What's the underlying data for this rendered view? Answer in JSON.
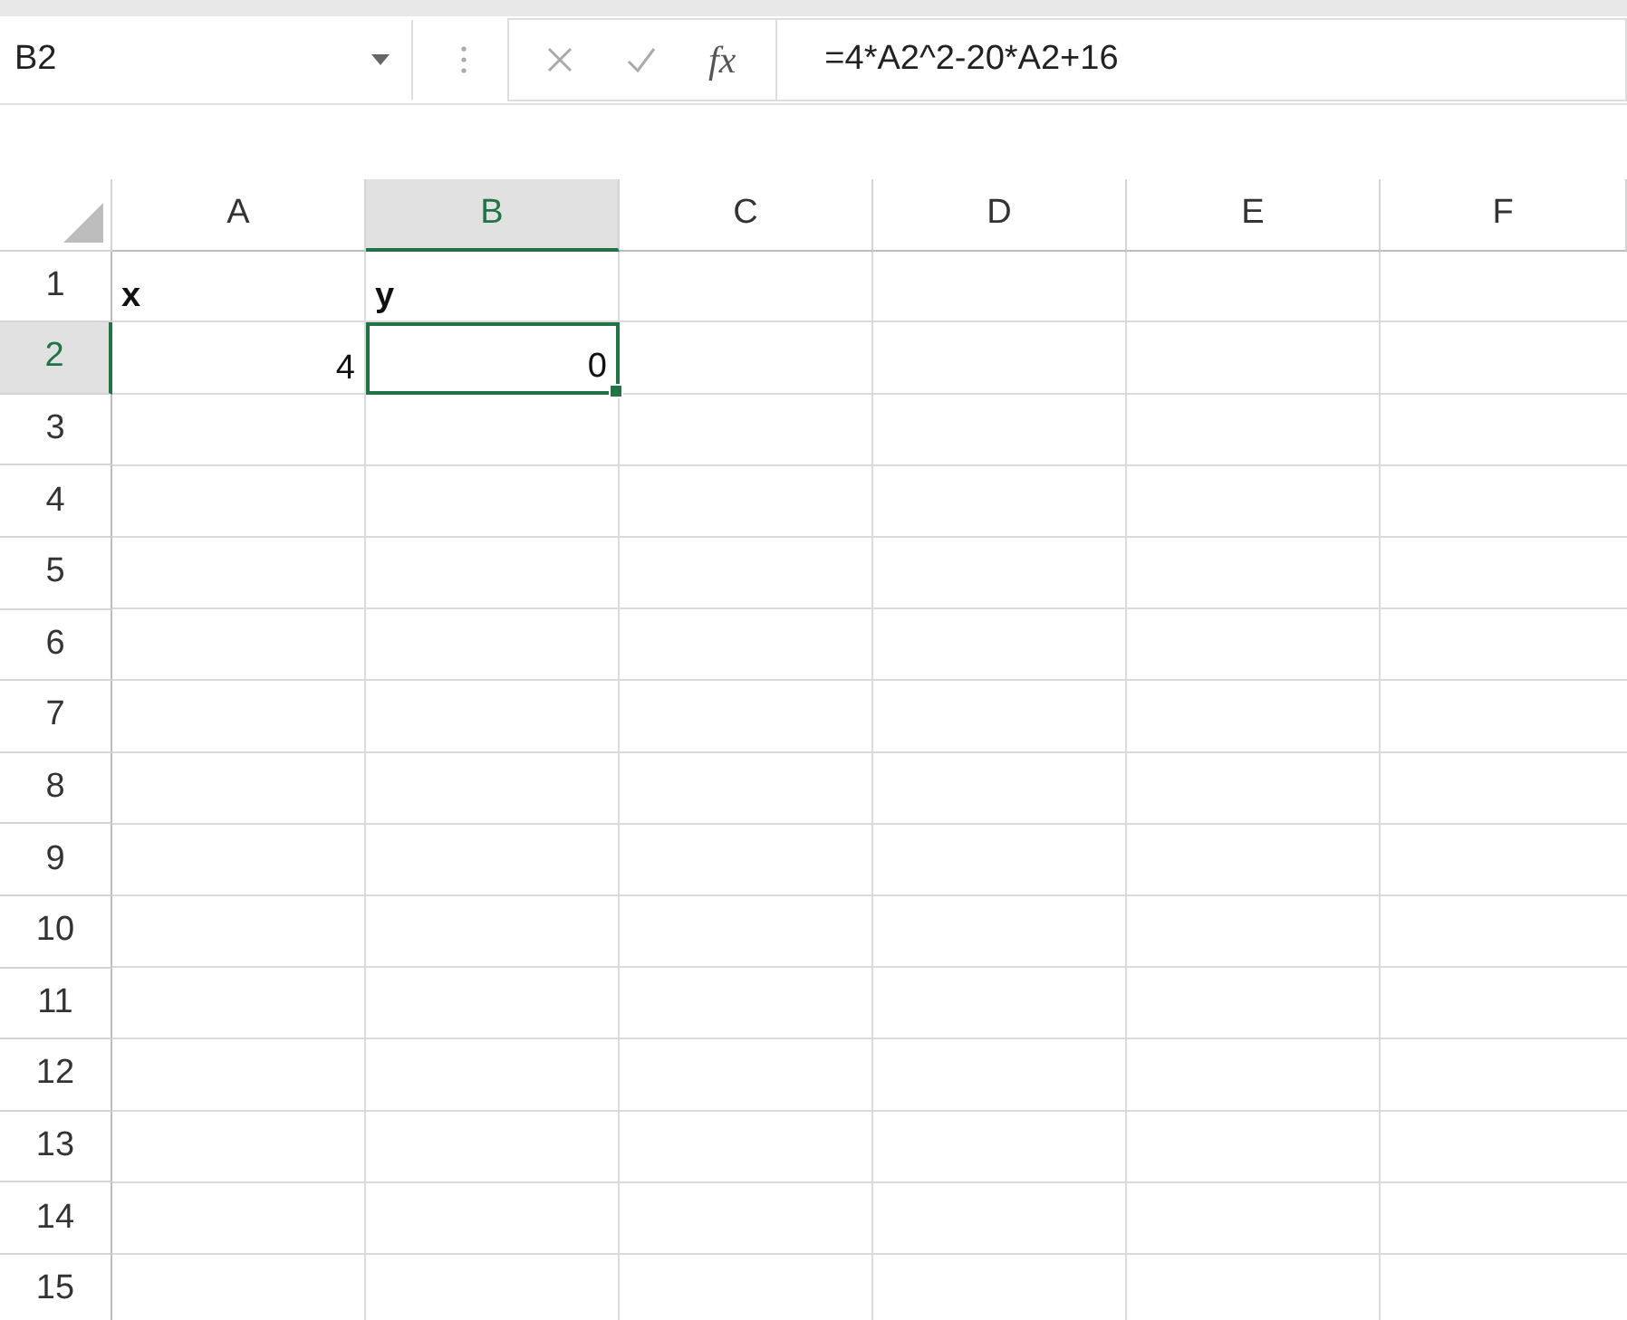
{
  "name_box": "B2",
  "function_label": "fx",
  "formula": "=4*A2^2-20*A2+16",
  "columns": [
    {
      "label": "A",
      "selected": false
    },
    {
      "label": "B",
      "selected": true
    },
    {
      "label": "C",
      "selected": false
    },
    {
      "label": "D",
      "selected": false
    },
    {
      "label": "E",
      "selected": false
    },
    {
      "label": "F",
      "selected": false
    }
  ],
  "rows": [
    {
      "label": "1",
      "selected": false,
      "cells": [
        {
          "text": "x",
          "kind": "label",
          "selected": false
        },
        {
          "text": "y",
          "kind": "label",
          "selected": false
        }
      ]
    },
    {
      "label": "2",
      "selected": true,
      "cells": [
        {
          "text": "4",
          "kind": "number",
          "selected": false
        },
        {
          "text": "0",
          "kind": "number",
          "selected": true
        }
      ]
    },
    {
      "label": "3",
      "selected": false
    },
    {
      "label": "4",
      "selected": false
    },
    {
      "label": "5",
      "selected": false
    },
    {
      "label": "6",
      "selected": false
    },
    {
      "label": "7",
      "selected": false
    },
    {
      "label": "8",
      "selected": false
    },
    {
      "label": "9",
      "selected": false
    },
    {
      "label": "10",
      "selected": false
    },
    {
      "label": "11",
      "selected": false
    },
    {
      "label": "12",
      "selected": false
    },
    {
      "label": "13",
      "selected": false
    },
    {
      "label": "14",
      "selected": false
    },
    {
      "label": "15",
      "selected": false
    }
  ]
}
